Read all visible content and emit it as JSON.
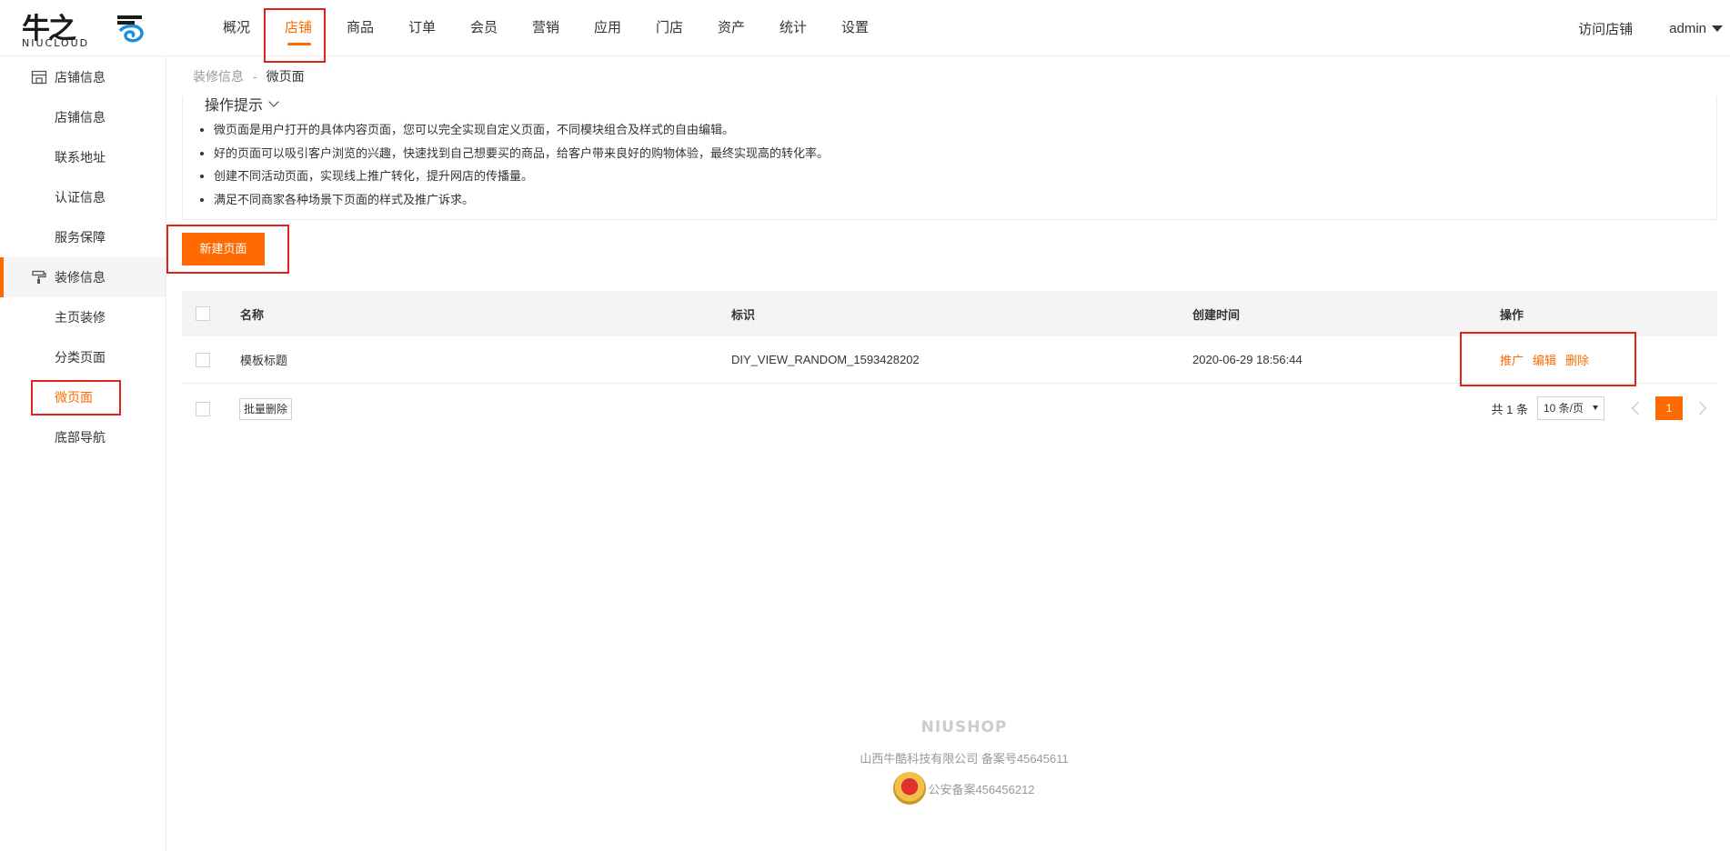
{
  "brand": {
    "logo_cn": "牛之",
    "logo_en": "NIUCLOUD"
  },
  "topnav": {
    "items": [
      {
        "label": "概况"
      },
      {
        "label": "店铺"
      },
      {
        "label": "商品"
      },
      {
        "label": "订单"
      },
      {
        "label": "会员"
      },
      {
        "label": "营销"
      },
      {
        "label": "应用"
      },
      {
        "label": "门店"
      },
      {
        "label": "资产"
      },
      {
        "label": "统计"
      },
      {
        "label": "设置"
      }
    ],
    "active": "店铺"
  },
  "header_right": {
    "visit_label": "访问店铺",
    "user": "admin"
  },
  "sidebar": {
    "groups": [
      {
        "label": "店铺信息",
        "icon": "store-icon",
        "items": [
          "店铺信息",
          "联系地址",
          "认证信息",
          "服务保障"
        ]
      },
      {
        "label": "装修信息",
        "icon": "paint-roller-icon",
        "items": [
          "主页装修",
          "分类页面",
          "微页面",
          "底部导航"
        ]
      }
    ],
    "active_item": "微页面"
  },
  "breadcrumb": {
    "parent": "装修信息",
    "separator": "-",
    "current": "微页面"
  },
  "tips": {
    "title": "操作提示",
    "items": [
      "微页面是用户打开的具体内容页面，您可以完全实现自定义页面，不同模块组合及样式的自由编辑。",
      "好的页面可以吸引客户浏览的兴趣，快速找到自己想要买的商品，给客户带来良好的购物体验，最终实现高的转化率。",
      "创建不同活动页面，实现线上推广转化，提升网店的传播量。",
      "满足不同商家各种场景下页面的样式及推广诉求。"
    ]
  },
  "actions": {
    "new_page": "新建页面",
    "batch_delete": "批量删除"
  },
  "table": {
    "columns": [
      "名称",
      "标识",
      "创建时间",
      "操作"
    ],
    "rows": [
      {
        "name": "模板标题",
        "identifier": "DIY_VIEW_RANDOM_1593428202",
        "created": "2020-06-29 18:56:44",
        "ops": [
          "推广",
          "编辑",
          "删除"
        ]
      }
    ]
  },
  "pagination": {
    "total": "共 1 条",
    "page_size": "10 条/页",
    "current_page": "1"
  },
  "footer": {
    "brand": "NIUSHOP",
    "company": "山西牛酷科技有限公司  备案号45645611",
    "police": "公安备案456456212"
  },
  "colors": {
    "accent": "#ff6a00",
    "annotation": "#e2231a"
  }
}
